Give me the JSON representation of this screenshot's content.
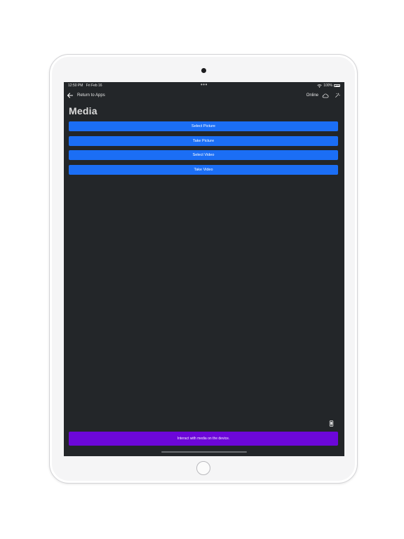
{
  "status_bar": {
    "time": "12:50 PM",
    "date": "Fri Feb 16",
    "dots": "•••",
    "battery_percent": "100%"
  },
  "nav": {
    "back_label": "Return to Apps",
    "status_label": "Online"
  },
  "page": {
    "title": "Media"
  },
  "buttons": [
    {
      "label": "Select Picture"
    },
    {
      "label": "Take Picture"
    },
    {
      "label": "Select Video"
    },
    {
      "label": "Take Video"
    }
  ],
  "info_bar": {
    "text": "Interact with media on the device."
  },
  "colors": {
    "screen_background": "#232629",
    "button_blue": "#1b6ef5",
    "info_bar_purple": "#6c07d9"
  },
  "icons": [
    "back-arrow-icon",
    "cloud-icon",
    "wand-icon",
    "wifi-icon",
    "battery-icon",
    "mobile-device-icon"
  ]
}
